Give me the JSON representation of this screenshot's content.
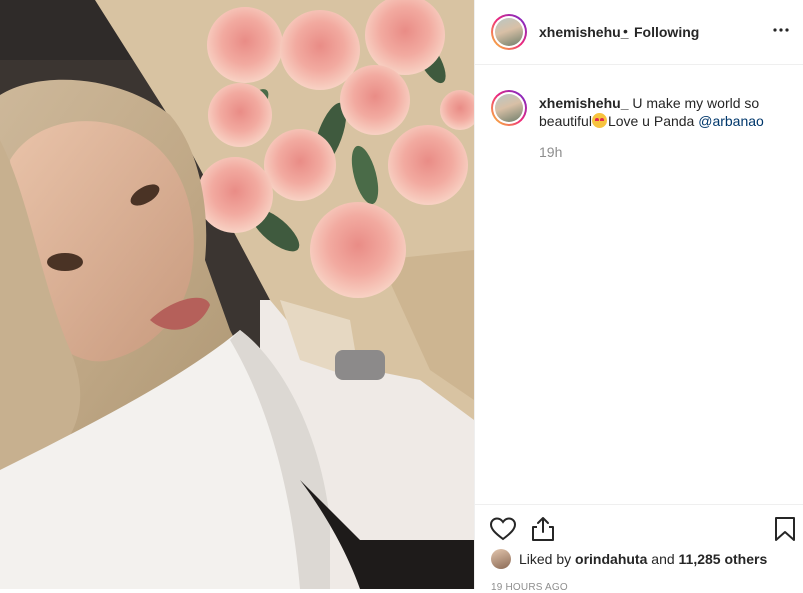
{
  "post": {
    "username": "xhemishehu_",
    "dot": "•",
    "follow_status": "Following",
    "more_icon": "more-options-icon",
    "photo": {
      "description_icon": "selfie-with-roses-image"
    }
  },
  "caption": {
    "username": "xhemishehu_",
    "text_before": "U make my world so beautiful",
    "emoji": "smiling-face-with-heart-eyes",
    "text_after": "Love u Panda ",
    "mention": "@arbanao",
    "time": "19h"
  },
  "actions": {
    "like_icon": "heart-icon",
    "share_icon": "share-icon",
    "save_icon": "bookmark-icon"
  },
  "likes": {
    "prefix": "Liked by",
    "user": "orindahuta",
    "and": "and",
    "count": "11,285 others"
  },
  "timestamp": "19 hours ago",
  "colors": {
    "mention": "#00376b",
    "muted": "#8e8e8e",
    "text": "#262626",
    "border": "#efefef"
  }
}
